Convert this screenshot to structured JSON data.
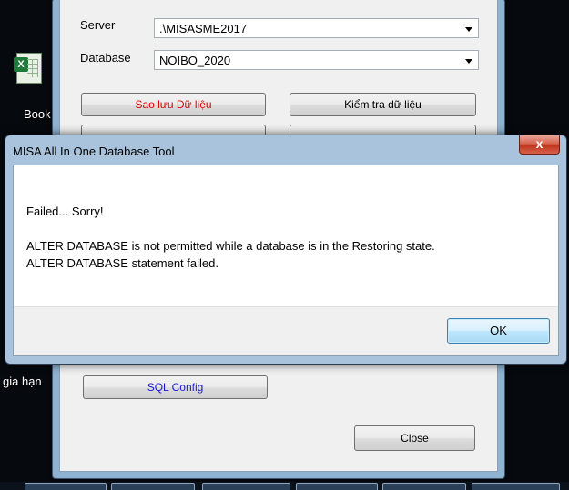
{
  "desktop": {
    "icon_label": "Book",
    "side_label": "gia hạn"
  },
  "tool_window": {
    "server_label": "Server",
    "server_value": ".\\MISASME2017",
    "database_label": "Database",
    "database_value": "NOIBO_2020",
    "backup_button": "Sao lưu Dữ liệu",
    "check_button": "Kiểm tra dữ liệu",
    "sql_config_button": "SQL Config",
    "close_button": "Close",
    "colors": {
      "backup_text": "#e00000",
      "sql_config_text": "#1a1ad0"
    }
  },
  "dialog": {
    "title": "MISA All In One Database Tool",
    "close_symbol": "x",
    "line1": "Failed... Sorry!",
    "line2": "ALTER DATABASE is not permitted while a database is in the Restoring state.",
    "line3": "ALTER DATABASE statement failed.",
    "ok_button": "OK"
  }
}
